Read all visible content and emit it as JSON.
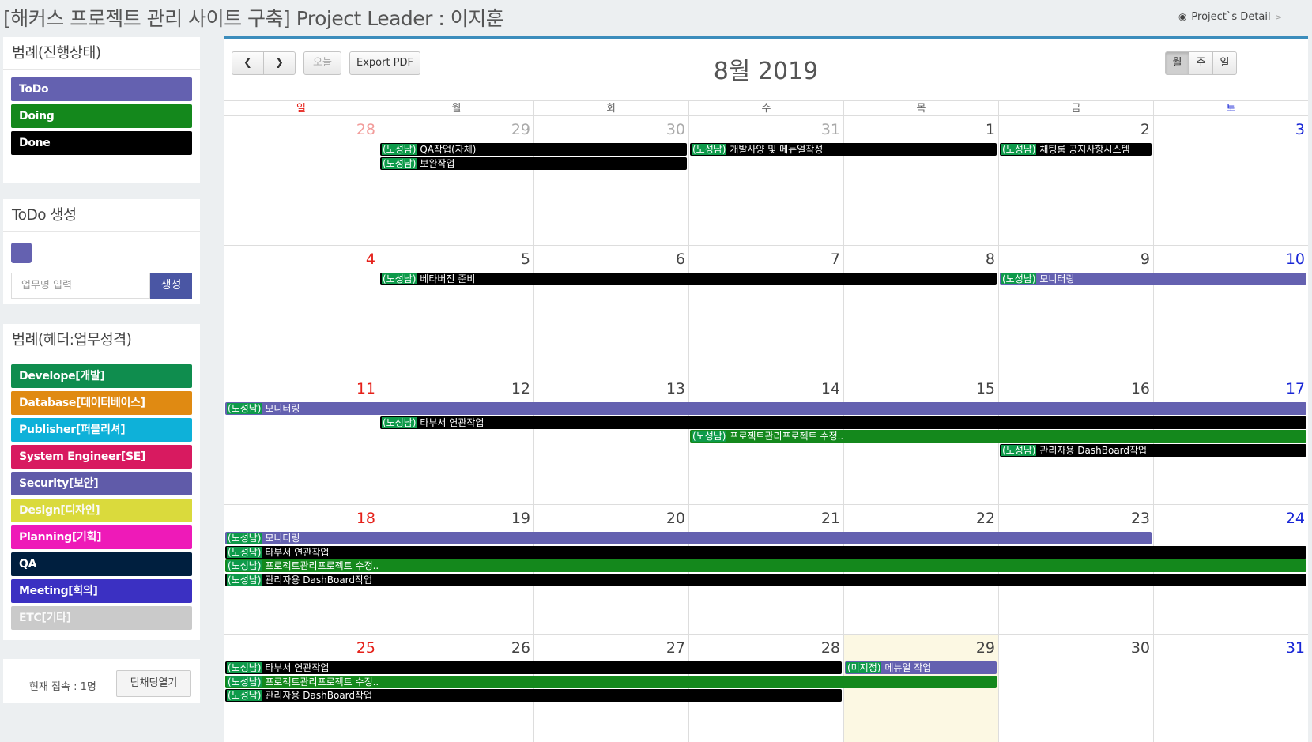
{
  "header": {
    "title": "[해커스 프로젝트 관리 사이트 구축] Project Leader : 이지훈",
    "detail_label": "Project`s Detail"
  },
  "status_legend": {
    "title": "범례(진행상태)",
    "items": [
      {
        "label": "ToDo",
        "color": "#6461b0"
      },
      {
        "label": "Doing",
        "color": "#14881c"
      },
      {
        "label": "Done",
        "color": "#000000"
      }
    ]
  },
  "todo_create": {
    "title": "ToDo 생성",
    "swatch_color": "#6461b0",
    "input_placeholder": "업무명 입력",
    "button_label": "생성"
  },
  "type_legend": {
    "title": "범례(헤더:업무성격)",
    "items": [
      {
        "label": "Develope[개발]",
        "color": "#0f8d4e"
      },
      {
        "label": "Database[데이터베이스]",
        "color": "#e08a12"
      },
      {
        "label": "Publisher[퍼블리셔]",
        "color": "#0eb1d9"
      },
      {
        "label": "System Engineer[SE]",
        "color": "#d81a60"
      },
      {
        "label": "Security[보안]",
        "color": "#605ba9"
      },
      {
        "label": "Design[디자인]",
        "color": "#dada3c"
      },
      {
        "label": "Planning[기획]",
        "color": "#ee1ab8"
      },
      {
        "label": "QA",
        "color": "#001f3f"
      },
      {
        "label": "Meeting[회의]",
        "color": "#3b30c2"
      },
      {
        "label": "ETC[기타]",
        "color": "#cacaca"
      }
    ]
  },
  "connection": {
    "status_text": "현재 접속 : 1명",
    "chat_button": "팀채팅열기"
  },
  "calendar": {
    "title": "8월 2019",
    "toolbar": {
      "today_label": "오늘",
      "export_label": "Export PDF",
      "views": [
        "월",
        "주",
        "일"
      ],
      "active_view": "월"
    },
    "weekdays": [
      "일",
      "월",
      "화",
      "수",
      "목",
      "금",
      "토"
    ],
    "weeks": [
      {
        "days": [
          {
            "num": "28",
            "other": true
          },
          {
            "num": "29",
            "other": true
          },
          {
            "num": "30",
            "other": true
          },
          {
            "num": "31",
            "other": true
          },
          {
            "num": "1",
            "other": false
          },
          {
            "num": "2",
            "other": false
          },
          {
            "num": "3",
            "other": false
          }
        ],
        "events": [
          {
            "start": 1,
            "span": 2,
            "row": 0,
            "tag": "(노성남)",
            "title": "QA작업(자체)",
            "color": "#000000"
          },
          {
            "start": 1,
            "span": 2,
            "row": 1,
            "tag": "(노성남)",
            "title": "보완작업",
            "color": "#000000"
          },
          {
            "start": 3,
            "span": 2,
            "row": 0,
            "tag": "(노성남)",
            "title": "개발사양 및 메뉴얼작성",
            "color": "#000000"
          },
          {
            "start": 5,
            "span": 1,
            "row": 0,
            "tag": "(노성남)",
            "title": "채팅룸 공지사항시스템",
            "color": "#000000"
          }
        ]
      },
      {
        "days": [
          {
            "num": "4",
            "other": false
          },
          {
            "num": "5",
            "other": false
          },
          {
            "num": "6",
            "other": false
          },
          {
            "num": "7",
            "other": false
          },
          {
            "num": "8",
            "other": false
          },
          {
            "num": "9",
            "other": false
          },
          {
            "num": "10",
            "other": false
          }
        ],
        "events": [
          {
            "start": 1,
            "span": 4,
            "row": 0,
            "tag": "(노성남)",
            "title": "베타버전 준비",
            "color": "#000000"
          },
          {
            "start": 5,
            "span": 2,
            "row": 0,
            "tag": "(노성남)",
            "title": "모니터링",
            "color": "#6461b0"
          }
        ]
      },
      {
        "days": [
          {
            "num": "11",
            "other": false
          },
          {
            "num": "12",
            "other": false
          },
          {
            "num": "13",
            "other": false
          },
          {
            "num": "14",
            "other": false
          },
          {
            "num": "15",
            "other": false
          },
          {
            "num": "16",
            "other": false
          },
          {
            "num": "17",
            "other": false
          }
        ],
        "events": [
          {
            "start": 0,
            "span": 7,
            "row": 0,
            "tag": "(노성남)",
            "title": "모니터링",
            "color": "#6461b0"
          },
          {
            "start": 1,
            "span": 6,
            "row": 1,
            "tag": "(노성남)",
            "title": "타부서 연관작업",
            "color": "#000000"
          },
          {
            "start": 3,
            "span": 4,
            "row": 2,
            "tag": "(노성남)",
            "title": "프로젝트관리프로젝트 수정..",
            "color": "#14881c"
          },
          {
            "start": 5,
            "span": 2,
            "row": 3,
            "tag": "(노성남)",
            "title": "관리자용 DashBoard작업",
            "color": "#000000"
          }
        ]
      },
      {
        "days": [
          {
            "num": "18",
            "other": false
          },
          {
            "num": "19",
            "other": false
          },
          {
            "num": "20",
            "other": false
          },
          {
            "num": "21",
            "other": false
          },
          {
            "num": "22",
            "other": false
          },
          {
            "num": "23",
            "other": false
          },
          {
            "num": "24",
            "other": false
          }
        ],
        "events": [
          {
            "start": 0,
            "span": 6,
            "row": 0,
            "tag": "(노성남)",
            "title": "모니터링",
            "color": "#6461b0"
          },
          {
            "start": 0,
            "span": 7,
            "row": 1,
            "tag": "(노성남)",
            "title": "타부서 연관작업",
            "color": "#000000"
          },
          {
            "start": 0,
            "span": 7,
            "row": 2,
            "tag": "(노성남)",
            "title": "프로젝트관리프로젝트 수정..",
            "color": "#14881c"
          },
          {
            "start": 0,
            "span": 7,
            "row": 3,
            "tag": "(노성남)",
            "title": "관리자용 DashBoard작업",
            "color": "#000000"
          }
        ]
      },
      {
        "days": [
          {
            "num": "25",
            "other": false
          },
          {
            "num": "26",
            "other": false
          },
          {
            "num": "27",
            "other": false
          },
          {
            "num": "28",
            "other": false
          },
          {
            "num": "29",
            "other": false,
            "today": true
          },
          {
            "num": "30",
            "other": false
          },
          {
            "num": "31",
            "other": false
          }
        ],
        "events": [
          {
            "start": 0,
            "span": 4,
            "row": 0,
            "tag": "(노성남)",
            "title": "타부서 연관작업",
            "color": "#000000"
          },
          {
            "start": 4,
            "span": 1,
            "row": 0,
            "tag": "(미지정)",
            "title": "메뉴얼 작업",
            "color": "#6461b0"
          },
          {
            "start": 0,
            "span": 5,
            "row": 1,
            "tag": "(노성남)",
            "title": "프로젝트관리프로젝트 수정..",
            "color": "#14881c"
          },
          {
            "start": 0,
            "span": 4,
            "row": 2,
            "tag": "(노성남)",
            "title": "관리자용 DashBoard작업",
            "color": "#000000"
          }
        ]
      }
    ]
  }
}
